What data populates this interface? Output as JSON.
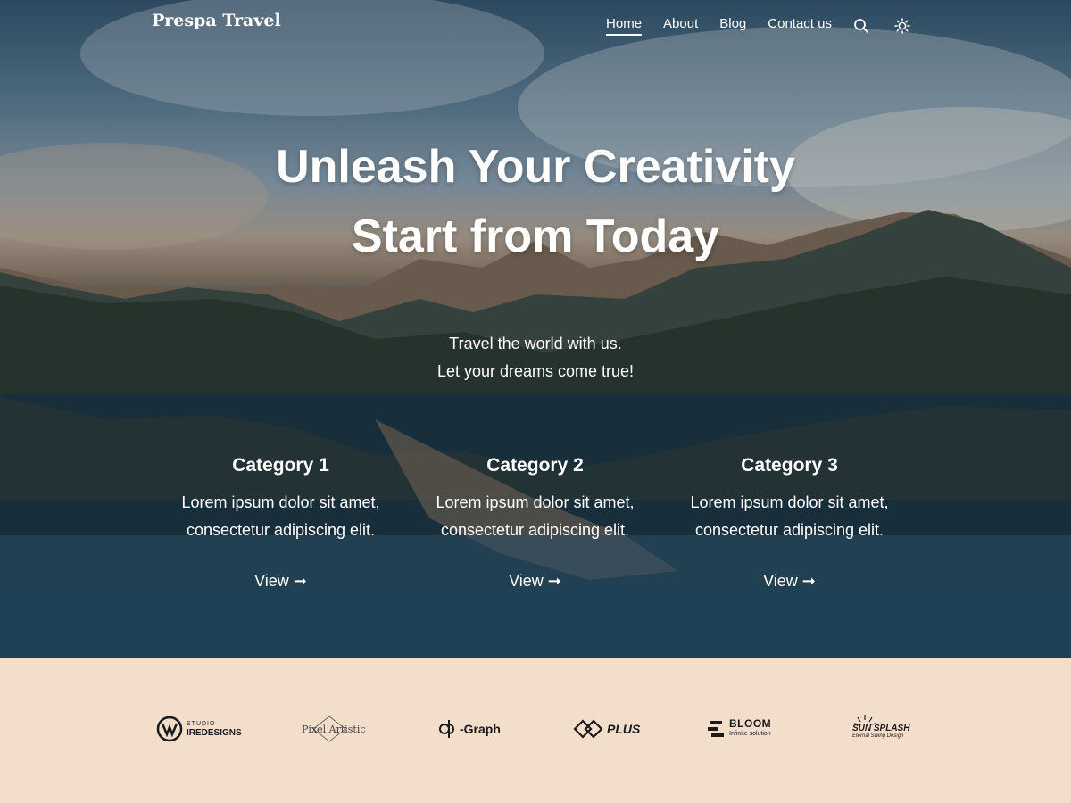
{
  "brand": "Prespa Travel",
  "nav": {
    "items": [
      {
        "label": "Home",
        "active": true
      },
      {
        "label": "About"
      },
      {
        "label": "Blog"
      },
      {
        "label": "Contact us"
      }
    ],
    "icons": [
      "search-icon",
      "sun-icon"
    ]
  },
  "hero": {
    "title_line1": "Unleash Your Creativity",
    "title_line2": "Start from Today",
    "sub_line1": "Travel the world with us.",
    "sub_line2": "Let your dreams come true!"
  },
  "categories": [
    {
      "title": "Category 1",
      "line1": "Lorem ipsum dolor sit amet,",
      "line2": "consectetur adipiscing elit.",
      "link": "View ➞"
    },
    {
      "title": "Category 2",
      "line1": "Lorem ipsum dolor sit amet,",
      "line2": "consectetur adipiscing elit.",
      "link": "View ➞"
    },
    {
      "title": "Category 3",
      "line1": "Lorem ipsum dolor sit amet,",
      "line2": "consectetur adipiscing elit.",
      "link": "View ➞"
    }
  ],
  "logos": [
    {
      "small": "STUDIO",
      "main": "IREDESIGNS"
    },
    {
      "main": "Pixel Artistic"
    },
    {
      "main": "-Graph"
    },
    {
      "main": "PLUS"
    },
    {
      "main": "BLOOM",
      "small": "Infinite solution"
    },
    {
      "main": "SUN SPLASH",
      "small": "Eternal Swing Design"
    }
  ],
  "colors": {
    "logo_strip_bg": "#f3decc",
    "text_light": "#ffffff"
  }
}
